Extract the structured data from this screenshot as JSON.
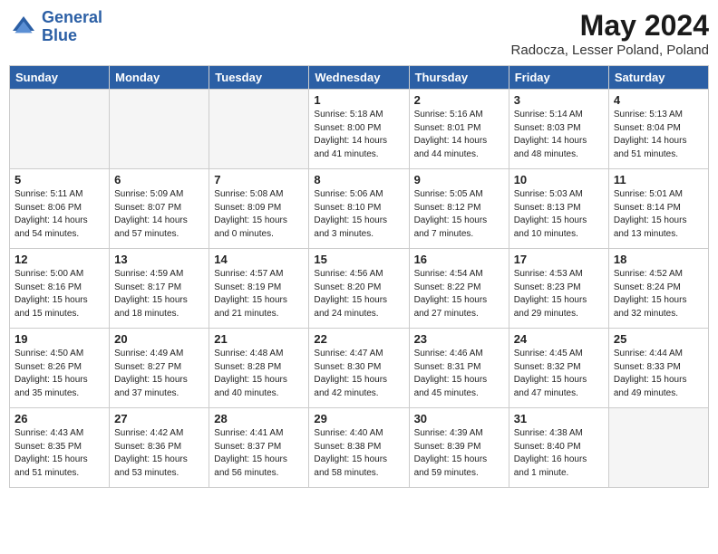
{
  "header": {
    "logo_general": "General",
    "logo_blue": "Blue",
    "month_title": "May 2024",
    "location": "Radocza, Lesser Poland, Poland"
  },
  "days_of_week": [
    "Sunday",
    "Monday",
    "Tuesday",
    "Wednesday",
    "Thursday",
    "Friday",
    "Saturday"
  ],
  "weeks": [
    [
      {
        "day": "",
        "info": ""
      },
      {
        "day": "",
        "info": ""
      },
      {
        "day": "",
        "info": ""
      },
      {
        "day": "1",
        "info": "Sunrise: 5:18 AM\nSunset: 8:00 PM\nDaylight: 14 hours\nand 41 minutes."
      },
      {
        "day": "2",
        "info": "Sunrise: 5:16 AM\nSunset: 8:01 PM\nDaylight: 14 hours\nand 44 minutes."
      },
      {
        "day": "3",
        "info": "Sunrise: 5:14 AM\nSunset: 8:03 PM\nDaylight: 14 hours\nand 48 minutes."
      },
      {
        "day": "4",
        "info": "Sunrise: 5:13 AM\nSunset: 8:04 PM\nDaylight: 14 hours\nand 51 minutes."
      }
    ],
    [
      {
        "day": "5",
        "info": "Sunrise: 5:11 AM\nSunset: 8:06 PM\nDaylight: 14 hours\nand 54 minutes."
      },
      {
        "day": "6",
        "info": "Sunrise: 5:09 AM\nSunset: 8:07 PM\nDaylight: 14 hours\nand 57 minutes."
      },
      {
        "day": "7",
        "info": "Sunrise: 5:08 AM\nSunset: 8:09 PM\nDaylight: 15 hours\nand 0 minutes."
      },
      {
        "day": "8",
        "info": "Sunrise: 5:06 AM\nSunset: 8:10 PM\nDaylight: 15 hours\nand 3 minutes."
      },
      {
        "day": "9",
        "info": "Sunrise: 5:05 AM\nSunset: 8:12 PM\nDaylight: 15 hours\nand 7 minutes."
      },
      {
        "day": "10",
        "info": "Sunrise: 5:03 AM\nSunset: 8:13 PM\nDaylight: 15 hours\nand 10 minutes."
      },
      {
        "day": "11",
        "info": "Sunrise: 5:01 AM\nSunset: 8:14 PM\nDaylight: 15 hours\nand 13 minutes."
      }
    ],
    [
      {
        "day": "12",
        "info": "Sunrise: 5:00 AM\nSunset: 8:16 PM\nDaylight: 15 hours\nand 15 minutes."
      },
      {
        "day": "13",
        "info": "Sunrise: 4:59 AM\nSunset: 8:17 PM\nDaylight: 15 hours\nand 18 minutes."
      },
      {
        "day": "14",
        "info": "Sunrise: 4:57 AM\nSunset: 8:19 PM\nDaylight: 15 hours\nand 21 minutes."
      },
      {
        "day": "15",
        "info": "Sunrise: 4:56 AM\nSunset: 8:20 PM\nDaylight: 15 hours\nand 24 minutes."
      },
      {
        "day": "16",
        "info": "Sunrise: 4:54 AM\nSunset: 8:22 PM\nDaylight: 15 hours\nand 27 minutes."
      },
      {
        "day": "17",
        "info": "Sunrise: 4:53 AM\nSunset: 8:23 PM\nDaylight: 15 hours\nand 29 minutes."
      },
      {
        "day": "18",
        "info": "Sunrise: 4:52 AM\nSunset: 8:24 PM\nDaylight: 15 hours\nand 32 minutes."
      }
    ],
    [
      {
        "day": "19",
        "info": "Sunrise: 4:50 AM\nSunset: 8:26 PM\nDaylight: 15 hours\nand 35 minutes."
      },
      {
        "day": "20",
        "info": "Sunrise: 4:49 AM\nSunset: 8:27 PM\nDaylight: 15 hours\nand 37 minutes."
      },
      {
        "day": "21",
        "info": "Sunrise: 4:48 AM\nSunset: 8:28 PM\nDaylight: 15 hours\nand 40 minutes."
      },
      {
        "day": "22",
        "info": "Sunrise: 4:47 AM\nSunset: 8:30 PM\nDaylight: 15 hours\nand 42 minutes."
      },
      {
        "day": "23",
        "info": "Sunrise: 4:46 AM\nSunset: 8:31 PM\nDaylight: 15 hours\nand 45 minutes."
      },
      {
        "day": "24",
        "info": "Sunrise: 4:45 AM\nSunset: 8:32 PM\nDaylight: 15 hours\nand 47 minutes."
      },
      {
        "day": "25",
        "info": "Sunrise: 4:44 AM\nSunset: 8:33 PM\nDaylight: 15 hours\nand 49 minutes."
      }
    ],
    [
      {
        "day": "26",
        "info": "Sunrise: 4:43 AM\nSunset: 8:35 PM\nDaylight: 15 hours\nand 51 minutes."
      },
      {
        "day": "27",
        "info": "Sunrise: 4:42 AM\nSunset: 8:36 PM\nDaylight: 15 hours\nand 53 minutes."
      },
      {
        "day": "28",
        "info": "Sunrise: 4:41 AM\nSunset: 8:37 PM\nDaylight: 15 hours\nand 56 minutes."
      },
      {
        "day": "29",
        "info": "Sunrise: 4:40 AM\nSunset: 8:38 PM\nDaylight: 15 hours\nand 58 minutes."
      },
      {
        "day": "30",
        "info": "Sunrise: 4:39 AM\nSunset: 8:39 PM\nDaylight: 15 hours\nand 59 minutes."
      },
      {
        "day": "31",
        "info": "Sunrise: 4:38 AM\nSunset: 8:40 PM\nDaylight: 16 hours\nand 1 minute."
      },
      {
        "day": "",
        "info": ""
      }
    ]
  ]
}
